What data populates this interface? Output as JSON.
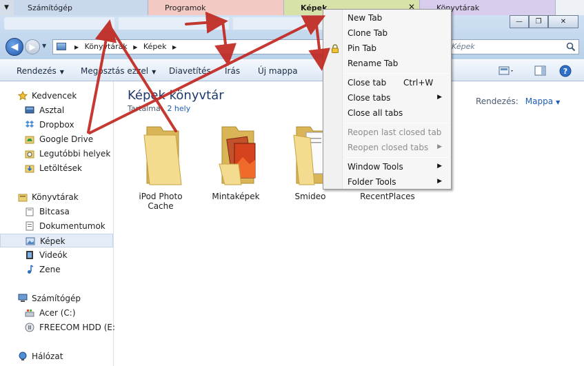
{
  "tabs": [
    {
      "label": "Számítógép",
      "color": "#c9d8ec"
    },
    {
      "label": "Programok",
      "color": "#f3c9c3"
    },
    {
      "label": "Képek",
      "color": "#d7e2a8",
      "active": true
    },
    {
      "label": "Könyvtárak",
      "color": "#d9cdee"
    }
  ],
  "window": {
    "buttons": {
      "minimize": "—",
      "maximize": "❐",
      "close": "✕"
    }
  },
  "address": {
    "path": [
      "Könyvtárak",
      "Képek"
    ],
    "search_placeholder": "Képek"
  },
  "toolbar": {
    "items": [
      {
        "label": "Rendezés",
        "dropdown": true
      },
      {
        "label": "Megosztás ezzel",
        "dropdown": true
      },
      {
        "label": "Diavetítés",
        "dropdown": false
      },
      {
        "label": "Írás",
        "dropdown": false
      },
      {
        "label": "Új mappa",
        "dropdown": false
      }
    ]
  },
  "sidebar": {
    "favorites": {
      "title": "Kedvencek",
      "items": [
        "Asztal",
        "Dropbox",
        "Google Drive",
        "Legutóbbi helyek",
        "Letöltések"
      ]
    },
    "libraries": {
      "title": "Könyvtárak",
      "items": [
        "Bitcasa",
        "Dokumentumok",
        "Képek",
        "Videók",
        "Zene"
      ]
    },
    "computer": {
      "title": "Számítógép",
      "items": [
        "Acer (C:)",
        "FREECOM HDD (E:)"
      ]
    },
    "network": {
      "title": "Hálózat"
    }
  },
  "main": {
    "title": "Képek könyvtár",
    "subtitle_label": "Tartalma:",
    "subtitle_value": "2 hely",
    "arrange_label": "Rendezés:",
    "arrange_value": "Mappa",
    "folders": [
      {
        "name": "iPod Photo Cache"
      },
      {
        "name": "Mintaképek"
      },
      {
        "name": "Smideo"
      },
      {
        "name": "RecentPlaces"
      }
    ]
  },
  "context_menu": {
    "items": [
      {
        "label": "New Tab"
      },
      {
        "label": "Clone Tab"
      },
      {
        "label": "Pin Tab",
        "icon": "lock-icon"
      },
      {
        "label": "Rename Tab"
      },
      {
        "label": "Close tab",
        "shortcut": "Ctrl+W"
      },
      {
        "label": "Close tabs",
        "submenu": true
      },
      {
        "label": "Close all tabs"
      },
      {
        "label": "Reopen last closed tab",
        "disabled": true
      },
      {
        "label": "Reopen closed tabs",
        "disabled": true,
        "submenu": true
      },
      {
        "label": "Window Tools",
        "submenu": true
      },
      {
        "label": "Folder Tools",
        "submenu": true
      }
    ]
  },
  "colors": {
    "accent": "#1c5bb6",
    "arrow": "#c0241c"
  }
}
